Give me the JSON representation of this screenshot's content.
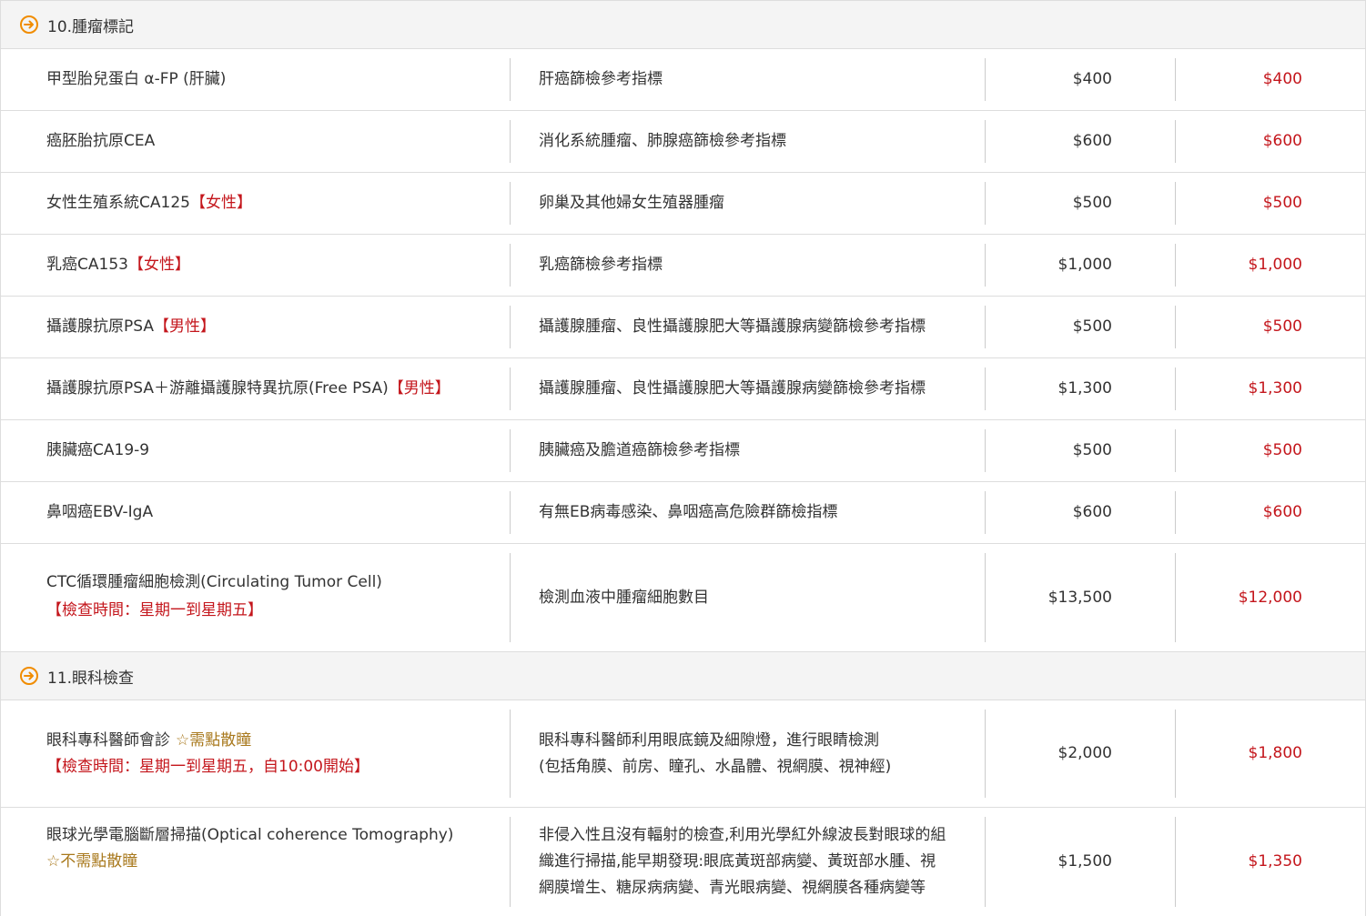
{
  "sections": [
    {
      "title": "10.腫瘤標記",
      "icon": "arrow-circle-icon",
      "rows": [
        {
          "name": "甲型胎兒蛋白 α-FP (肝臟)",
          "tag": "",
          "desc": [
            "肝癌篩檢參考指標"
          ],
          "price": "$400",
          "sale": "$400"
        },
        {
          "name": "癌胚胎抗原CEA",
          "tag": "",
          "desc": [
            "消化系統腫瘤、肺腺癌篩檢參考指標"
          ],
          "price": "$600",
          "sale": "$600"
        },
        {
          "name": "女性生殖系統CA125",
          "tag": "【女性】",
          "desc": [
            "卵巢及其他婦女生殖器腫瘤"
          ],
          "price": "$500",
          "sale": "$500"
        },
        {
          "name": "乳癌CA153",
          "tag": "【女性】",
          "desc": [
            "乳癌篩檢參考指標"
          ],
          "price": "$1,000",
          "sale": "$1,000"
        },
        {
          "name": "攝護腺抗原PSA",
          "tag": "【男性】",
          "desc": [
            "攝護腺腫瘤、良性攝護腺肥大等攝護腺病變篩檢參考指標"
          ],
          "price": "$500",
          "sale": "$500"
        },
        {
          "name": "攝護腺抗原PSA＋游離攝護腺特異抗原(Free PSA)",
          "tag": "【男性】",
          "desc": [
            "攝護腺腫瘤、良性攝護腺肥大等攝護腺病變篩檢參考指標"
          ],
          "price": "$1,300",
          "sale": "$1,300"
        },
        {
          "name": "胰臟癌CA19-9",
          "tag": "",
          "desc": [
            "胰臟癌及膽道癌篩檢參考指標"
          ],
          "price": "$500",
          "sale": "$500"
        },
        {
          "name": "鼻咽癌EBV-IgA",
          "tag": "",
          "desc": [
            "有無EB病毒感染、鼻咽癌高危險群篩檢指標"
          ],
          "price": "$600",
          "sale": "$600"
        },
        {
          "name": "CTC循環腫瘤細胞檢測(Circulating Tumor Cell)",
          "tag": "",
          "note": "【檢查時間：星期一到星期五】",
          "desc": [
            "檢測血液中腫瘤細胞數目"
          ],
          "price": "$13,500",
          "sale": "$12,000"
        }
      ]
    },
    {
      "title": "11.眼科檢查",
      "icon": "arrow-circle-icon",
      "rows": [
        {
          "name": "眼科專科醫師會診",
          "star": "☆需點散瞳",
          "note": "【檢查時間：星期一到星期五，自10:00開始】",
          "desc": [
            "眼科專科醫師利用眼底鏡及細隙燈，進行眼睛檢測",
            "(包括角膜、前房、瞳孔、水晶體、視網膜、視神經)"
          ],
          "price": "$2,000",
          "sale": "$1,800"
        },
        {
          "name": "眼球光學電腦斷層掃描(Optical coherence Tomography)",
          "star_line": "☆不需點散瞳",
          "desc": [
            "非侵入性且沒有輻射的檢查,利用光學紅外線波長對眼球的組",
            "織進行掃描,能早期發現:眼底黃斑部病變、黃斑部水腫、視",
            "網膜增生、糖尿病病變、青光眼病變、視網膜各種病變等"
          ],
          "price": "$1,500",
          "sale": "$1,350"
        }
      ]
    }
  ],
  "colors": {
    "accent": "#f08c00",
    "sale": "#c4161c",
    "star": "#a8781c",
    "header_bg": "#f4f4f4",
    "border": "#dddddd"
  }
}
